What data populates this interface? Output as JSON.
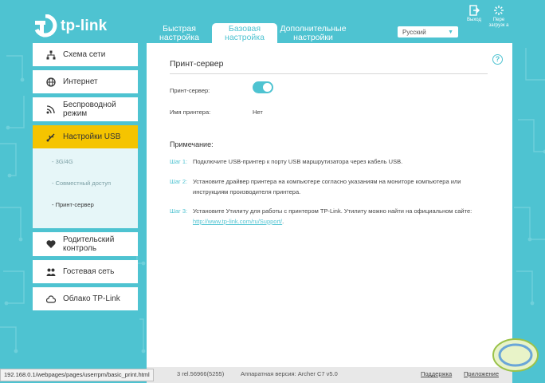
{
  "brand": {
    "logo_text": "tp-link"
  },
  "header": {
    "tabs": [
      {
        "label": "Быстрая настройка",
        "active": false
      },
      {
        "label": "Базовая настройка",
        "active": true
      },
      {
        "label": "Дополнительные настройки",
        "active": false
      }
    ],
    "language": "Русский",
    "logout_label": "Выход",
    "reboot_label": "Пере загрузк а"
  },
  "sidebar": {
    "items": [
      {
        "label": "Схема сети",
        "icon": "network-map-icon"
      },
      {
        "label": "Интернет",
        "icon": "globe-icon"
      },
      {
        "label": "Беспроводной режим",
        "icon": "wifi-icon"
      },
      {
        "label": "Настройки USB",
        "icon": "usb-icon",
        "active": true
      },
      {
        "label": "Родительский контроль",
        "icon": "parental-control-icon"
      },
      {
        "label": "Гостевая сеть",
        "icon": "guest-network-icon"
      },
      {
        "label": "Облако TP-Link",
        "icon": "cloud-icon"
      }
    ],
    "usb_sub": [
      {
        "label": "- 3G/4G"
      },
      {
        "label": "- Совместный доступ"
      },
      {
        "label": "- Принт-сервер",
        "active": true
      }
    ]
  },
  "main": {
    "section_title": "Принт-сервер",
    "print_server_label": "Принт-сервер:",
    "print_server_enabled": true,
    "printer_name_label": "Имя принтера:",
    "printer_name_value": "Нет",
    "note_title": "Примечание:",
    "steps": [
      {
        "label": "Шаг 1:",
        "text": "Подключите USB-принтер к порту USB маршрутизатора через кабель USB."
      },
      {
        "label": "Шаг 2:",
        "text": "Установите драйвер принтера на компьютере согласно указаниям на мониторе компьютера или инструкциям производителя принтера."
      },
      {
        "label": "Шаг 3:",
        "text": "Установите Утилиту для работы с принтером TP-Link. Утилиту можно найти на официальном сайте:",
        "link": "http://www.tp-link.com/ru/Support/",
        "suffix": "."
      }
    ]
  },
  "footer": {
    "firmware": "3 rel.56966(5255)",
    "hardware": "Аппаратная версия: Archer C7 v5.0",
    "support": "Поддержка",
    "app": "Приложение"
  },
  "statusbar": {
    "url": "192.168.0.1/webpages/pages/userrpm/basic_print.html"
  },
  "colors": {
    "accent": "#4ec3d1",
    "active_nav": "#f5c400"
  }
}
